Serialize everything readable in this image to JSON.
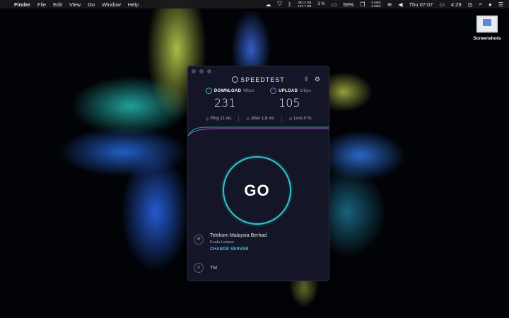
{
  "menubar": {
    "apple": "",
    "items": [
      "Finder",
      "File",
      "Edit",
      "View",
      "Go",
      "Window",
      "Help"
    ],
    "disk_top": "363.3 GB",
    "disk_bottom": "137.7 GB",
    "cpu": "3 %",
    "battery": "59%",
    "net_up": "0 KB/s",
    "net_down": "0 KB/s",
    "clock": "Thu 07:07",
    "time2": "4:29"
  },
  "desktop": {
    "icon_label": "Screenshots"
  },
  "speedtest": {
    "brand": "SPEEDTEST",
    "download_label": "DOWNLOAD",
    "download_unit": "Mbps",
    "download_value": "231",
    "upload_label": "UPLOAD",
    "upload_unit": "Mbps",
    "upload_value": "105",
    "ping": "Ping 11 ms",
    "jitter": "Jitter 1.8 ms",
    "loss": "Loss 0 %",
    "go_label": "GO",
    "server_name": "Telekom Malaysia Berhad",
    "server_city": "Kuala Lumpur",
    "change_server": "CHANGE SERVER",
    "isp": "TM"
  },
  "colors": {
    "accent_cyan": "#2fc6d0",
    "accent_purple": "#b46be0",
    "window_bg": "#141526"
  }
}
